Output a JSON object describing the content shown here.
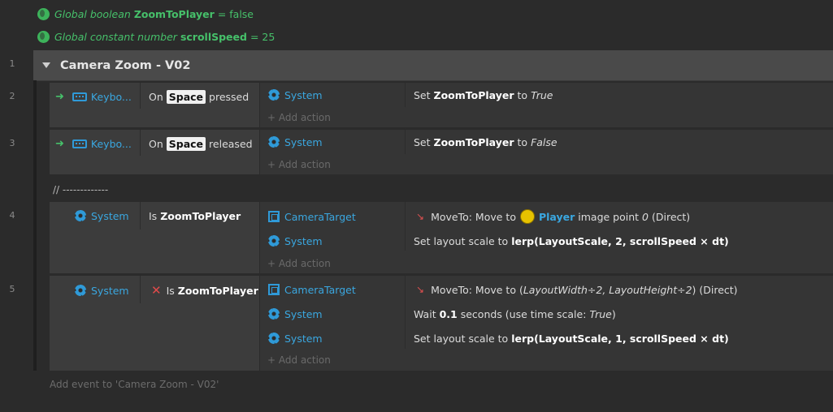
{
  "globals": [
    {
      "prefix": "Global boolean",
      "name": "ZoomToPlayer",
      "eq": "= false"
    },
    {
      "prefix": "Global constant number",
      "name": "scrollSpeed",
      "eq": "= 25"
    }
  ],
  "group": {
    "line": "1",
    "title": "Camera Zoom - V02"
  },
  "lines": [
    "2",
    "3",
    "4",
    "5"
  ],
  "events": [
    {
      "obj": "Keybo...",
      "cond_pre": "On",
      "key": "Space",
      "cond_post": "pressed",
      "act_obj": "System",
      "act_pre": "Set",
      "act_var": "ZoomToPlayer",
      "act_to": "to",
      "act_val": "True"
    },
    {
      "obj": "Keybo...",
      "cond_pre": "On",
      "key": "Space",
      "cond_post": "released",
      "act_obj": "System",
      "act_pre": "Set",
      "act_var": "ZoomToPlayer",
      "act_to": "to",
      "act_val": "False"
    }
  ],
  "add_action": "Add action",
  "comment": "//  -------------",
  "event4": {
    "cond_obj": "System",
    "cond_pre": "Is",
    "cond_var": "ZoomToPlayer",
    "a1_obj": "CameraTarget",
    "a1_pre": "MoveTo: Move to",
    "a1_player": "Player",
    "a1_mid": "image point",
    "a1_pt": "0",
    "a1_post": "(Direct)",
    "a2_obj": "System",
    "a2_pre": "Set layout scale to",
    "a2_expr": "lerp(LayoutScale, 2, scrollSpeed × dt)"
  },
  "event5": {
    "cond_obj": "System",
    "cond_pre": "Is",
    "cond_var": "ZoomToPlayer",
    "a1_obj": "CameraTarget",
    "a1_pre": "MoveTo: Move to (",
    "a1_expr": "LayoutWidth÷2, LayoutHeight÷2",
    "a1_post": ") (Direct)",
    "a2_obj": "System",
    "a2_pre": "Wait",
    "a2_num": "0.1",
    "a2_mid": "seconds (use time scale:",
    "a2_val": "True",
    "a2_post": ")",
    "a3_obj": "System",
    "a3_pre": "Set layout scale to",
    "a3_expr": "lerp(LayoutScale, 1, scrollSpeed × dt)"
  },
  "add_event": "Add event to 'Camera Zoom - V02'"
}
